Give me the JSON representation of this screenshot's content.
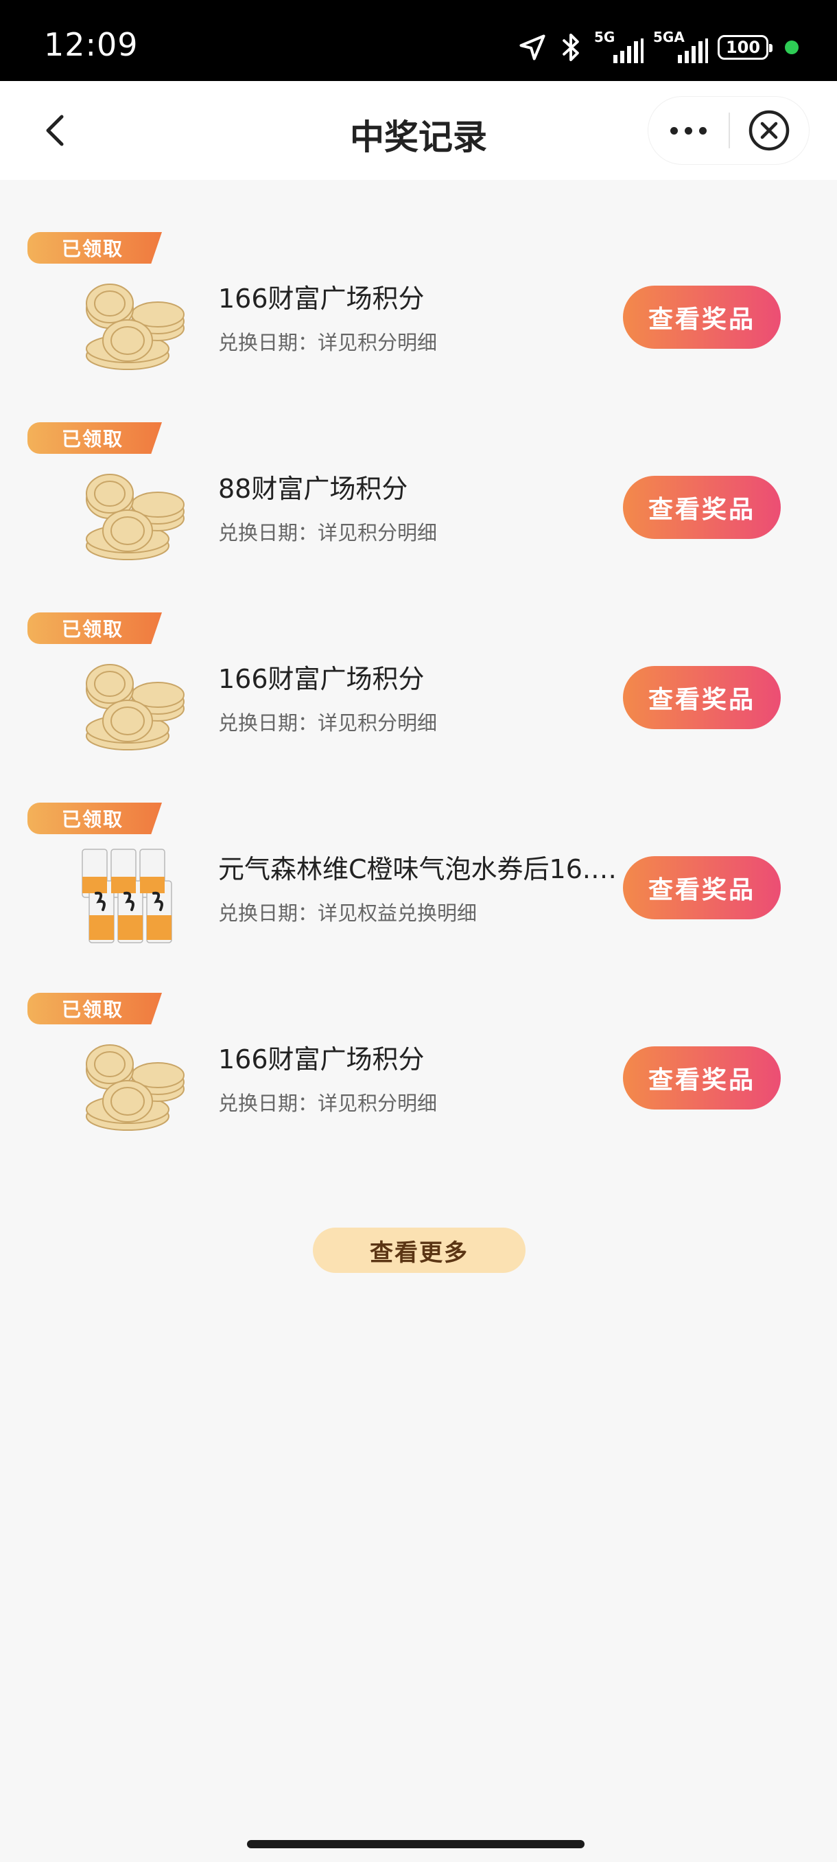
{
  "status_bar": {
    "time": "12:09",
    "network_1": "5G",
    "network_2": "5GA",
    "battery": "100",
    "icons": [
      "location-arrow-icon",
      "bluetooth-icon",
      "signal-icon",
      "signal-icon",
      "battery-icon",
      "green-dot"
    ]
  },
  "nav": {
    "title": "中奖记录",
    "back_icon": "chevron-left-icon",
    "more_icon": "more-dots-icon",
    "close_icon": "close-circle-icon"
  },
  "records": [
    {
      "badge": "已领取",
      "title": "166财富广场积分",
      "subtitle": "兑换日期：详见积分明细",
      "button": "查看奖品",
      "image": "gold-coins-icon"
    },
    {
      "badge": "已领取",
      "title": "88财富广场积分",
      "subtitle": "兑换日期：详见积分明细",
      "button": "查看奖品",
      "image": "gold-coins-icon"
    },
    {
      "badge": "已领取",
      "title": "166财富广场积分",
      "subtitle": "兑换日期：详见积分明细",
      "button": "查看奖品",
      "image": "gold-coins-icon"
    },
    {
      "badge": "已领取",
      "title": "元气森林维C橙味气泡水券后16.…",
      "subtitle": "兑换日期：详见权益兑换明细",
      "button": "查看奖品",
      "image": "drink-cans-icon"
    },
    {
      "badge": "已领取",
      "title": "166财富广场积分",
      "subtitle": "兑换日期：详见积分明细",
      "button": "查看奖品",
      "image": "gold-coins-icon"
    }
  ],
  "more_button": "查看更多",
  "colors": {
    "badge_gradient": [
      "#f3b159",
      "#f07a3f"
    ],
    "button_gradient": [
      "#f3894b",
      "#ec4e74"
    ],
    "more_button_bg": "#fbe1b2",
    "page_bg": "#f7f7f7"
  }
}
